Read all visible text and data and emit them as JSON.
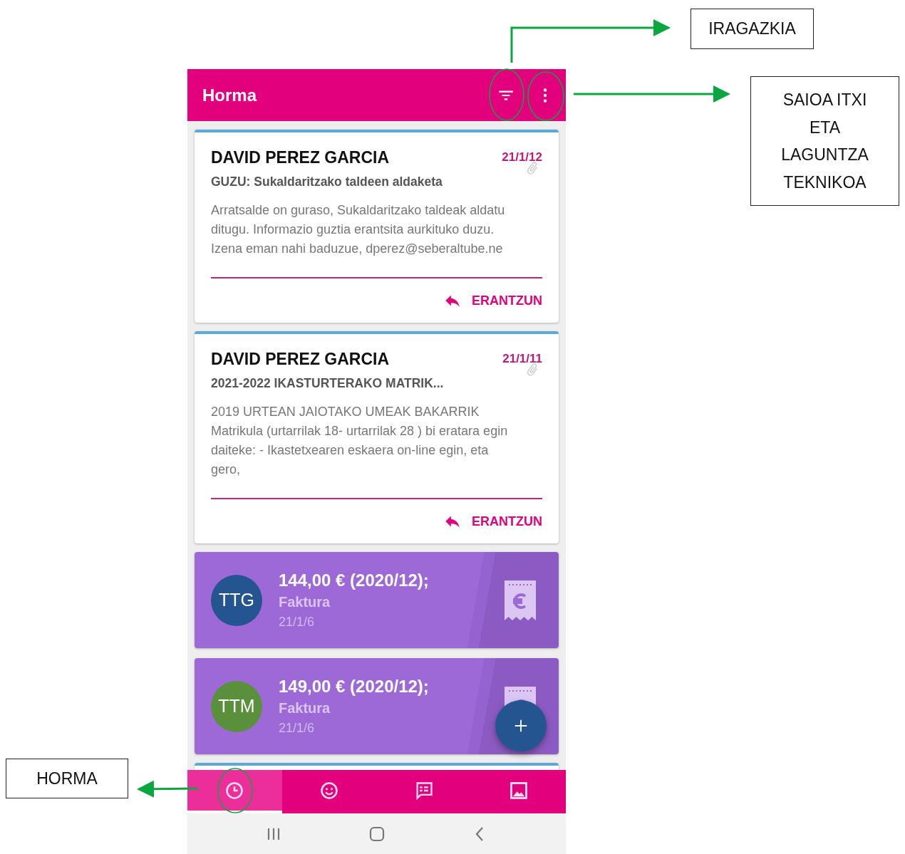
{
  "header": {
    "title": "Horma"
  },
  "cards": [
    {
      "kind": "message",
      "sender": "DAVID PEREZ GARCIA",
      "date": "21/1/12",
      "attachment": true,
      "subject": "GUZU: Sukaldaritzako taldeen aldaketa",
      "body_lines": [
        "Arratsalde on guraso, Sukaldaritzako taldeak aldatu",
        "ditugu. Informazio guztia erantsita aurkituko duzu.",
        "Izena eman nahi baduzue, dperez@seberaltube.ne"
      ],
      "action": "ERANTZUN"
    },
    {
      "kind": "message",
      "sender": "DAVID PEREZ GARCIA",
      "date": "21/1/11",
      "attachment": true,
      "subject": "2021-2022 IKASTURTERAKO MATRIK...",
      "body_lines": [
        "2019 URTEAN JAIOTAKO UMEAK BAKARRIK",
        "Matrikula (urtarrilak 18- urtarrilak 28 ) bi eratara egin",
        "daiteke: - Ikastetxearen eskaera on-line egin, eta",
        "gero,"
      ],
      "action": "ERANTZUN"
    },
    {
      "kind": "invoice",
      "initials": "TTG",
      "color": "#245590",
      "amount": "144,00 € (2020/12);",
      "type": "Faktura",
      "date": "21/1/6"
    },
    {
      "kind": "invoice",
      "initials": "TTM",
      "color": "#5a8f3c",
      "amount": "149,00 € (2020/12);",
      "type": "Faktura",
      "date": "21/1/6"
    },
    {
      "kind": "message"
    }
  ],
  "bottom_nav": [
    {
      "kind": "clock",
      "selected": true
    },
    {
      "kind": "smiley",
      "selected": false
    },
    {
      "kind": "chat",
      "selected": false
    },
    {
      "kind": "image",
      "selected": false
    }
  ],
  "callouts": [
    {
      "lines": [
        "IRAGAZKIA"
      ]
    },
    {
      "lines": [
        "SAIOA ITXI",
        "ETA",
        "LAGUNTZA",
        "TEKNIKOA"
      ]
    },
    {
      "lines": [
        "HORMA"
      ]
    }
  ]
}
